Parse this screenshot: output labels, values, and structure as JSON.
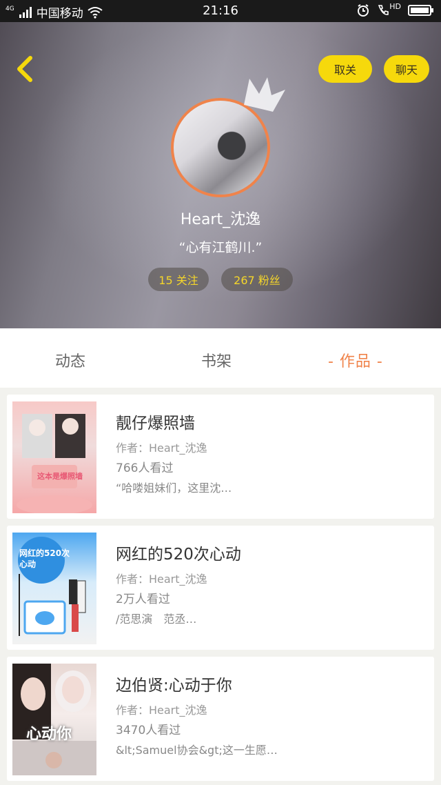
{
  "status_bar": {
    "network": "4G",
    "carrier": "中国移动",
    "time": "21:16",
    "hd": "HD",
    "icons": [
      "signal-icon",
      "wifi-icon",
      "alarm-icon",
      "phone-icon",
      "battery-icon"
    ]
  },
  "profile": {
    "unfollow_label": "取关",
    "chat_label": "聊天",
    "username": "Heart_沈逸",
    "signature": "“心有江鹤川.”",
    "following": "15 关注",
    "fans": "267 粉丝"
  },
  "tabs": [
    {
      "label": "动态"
    },
    {
      "label": "书架"
    },
    {
      "label": "- 作品 -"
    }
  ],
  "works": [
    {
      "title": "靓仔爆照墙",
      "author": "作者：Heart_沈逸",
      "views": "766人看过",
      "snippet": "“哈喽姐妹们，这里沈…",
      "cover_text": "这本是爆照墙"
    },
    {
      "title": "网红的520次心动",
      "author": "作者：Heart_沈逸",
      "views": "2万人看过",
      "snippet": "/范思演　范丞…",
      "cover_text": "网红的520次心动"
    },
    {
      "title": "边伯贤:心动于你",
      "author": "作者：Heart_沈逸",
      "views": "3470人看过",
      "snippet": "&lt;Samuel协会&gt;这一生愿…",
      "cover_text": "心动你"
    }
  ],
  "colors": {
    "accent_yellow": "#f6d90c",
    "accent_orange": "#f0834a",
    "fans_text": "#f5d62a"
  }
}
